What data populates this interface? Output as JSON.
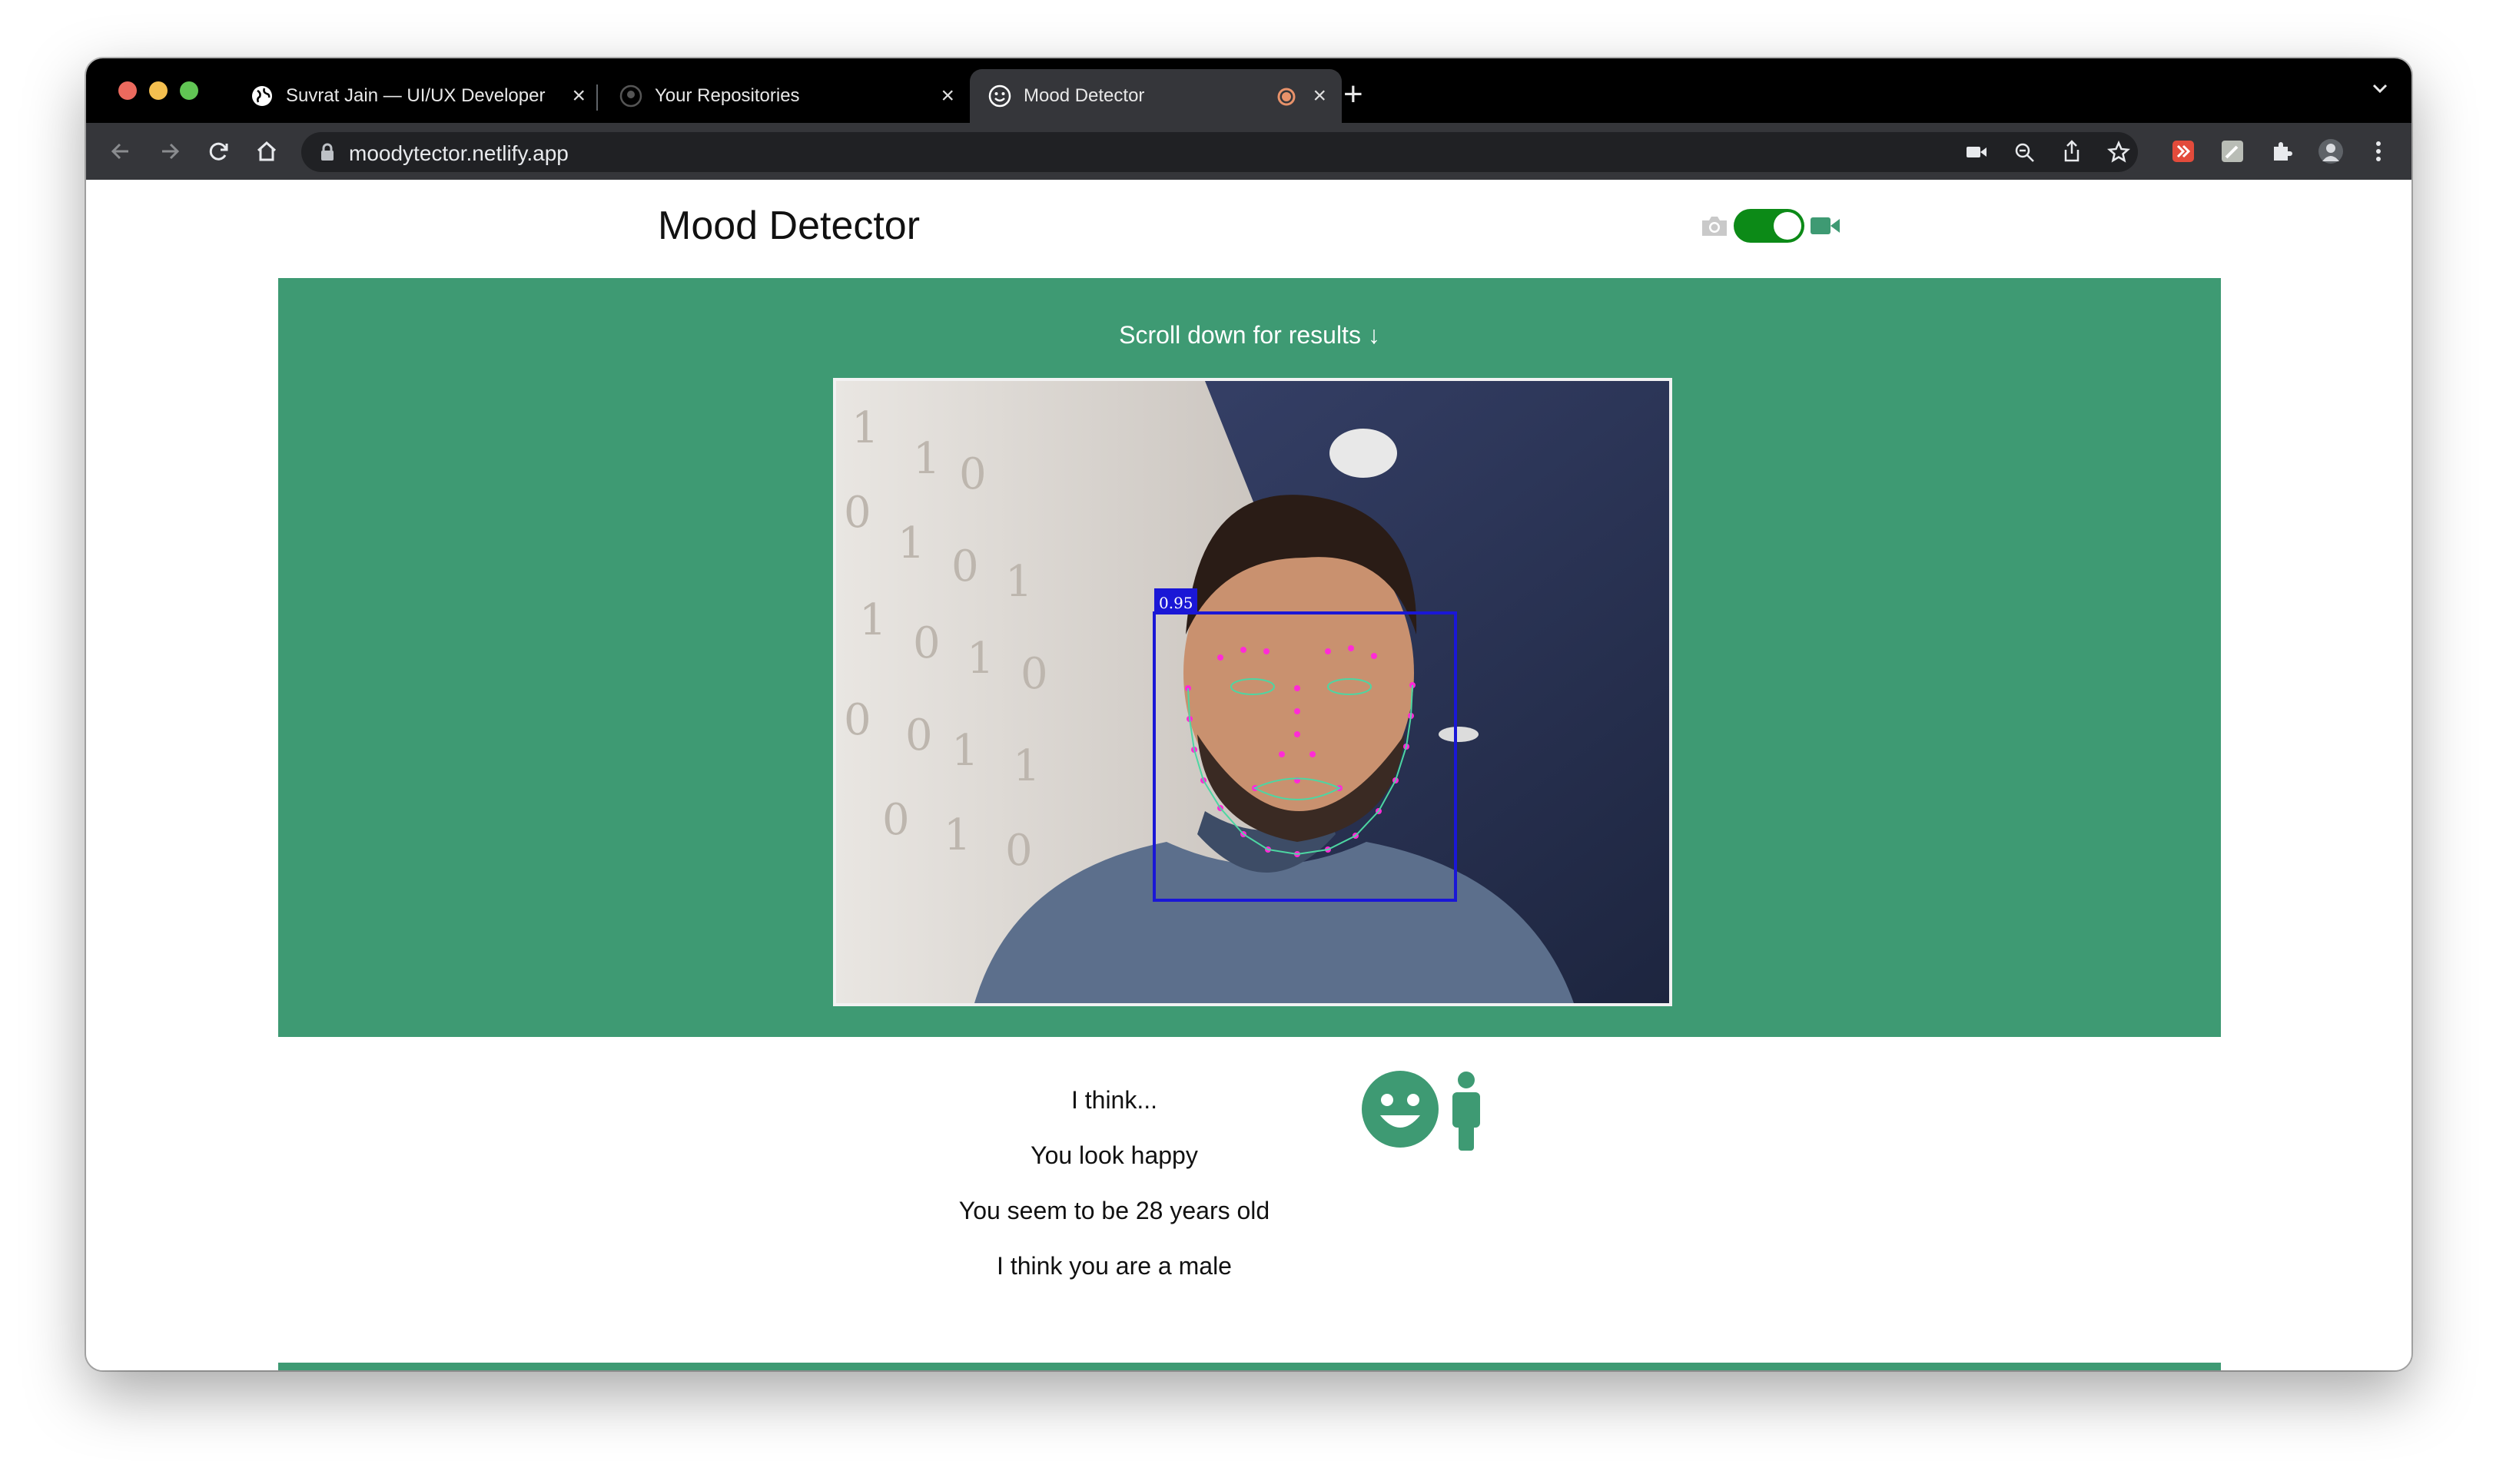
{
  "browser": {
    "tabs": [
      {
        "title": "Suvrat Jain — UI/UX Developer",
        "active": false
      },
      {
        "title": "Your Repositories",
        "active": false
      },
      {
        "title": "Mood Detector",
        "active": true
      }
    ],
    "close_glyph": "×",
    "new_tab_glyph": "+",
    "address": "moodytector.netlify.app"
  },
  "app": {
    "title": "Mood Detector",
    "mode_toggle": {
      "photo_icon": "camera-icon",
      "video_icon": "video-camera-icon",
      "state": "video"
    },
    "scroll_hint": "Scroll down for results ↓",
    "detection": {
      "score": "0.95"
    },
    "results": [
      "I think...",
      "You look happy",
      "You seem to be 28 years old",
      "I think you are a male"
    ],
    "result_icons": [
      "happy-face-icon",
      "person-icon"
    ]
  },
  "colors": {
    "brand_green": "#3e9a73",
    "toggle_green": "#0c8a17",
    "detection_box": "#1a17d6",
    "landmarks": "#ff2bd6"
  }
}
